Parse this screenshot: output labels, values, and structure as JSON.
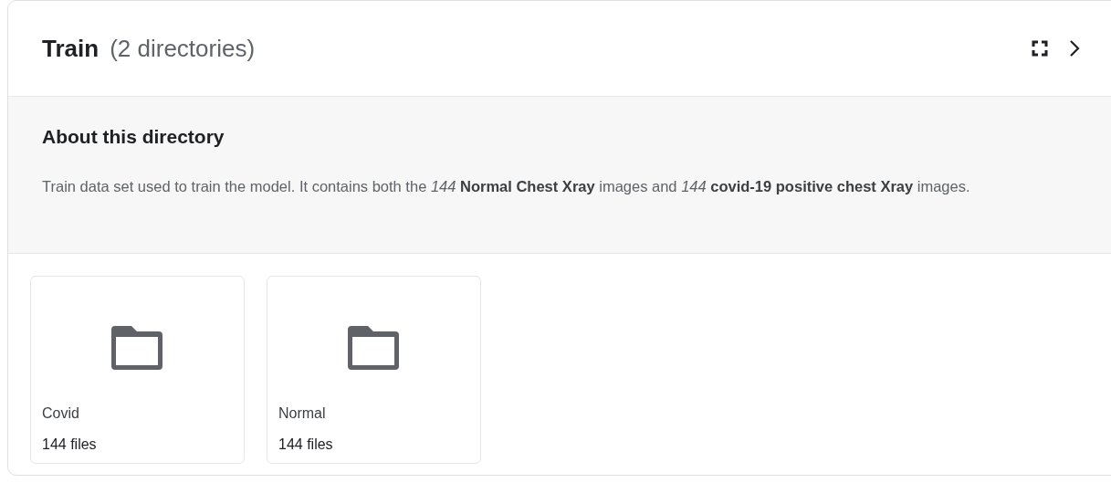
{
  "header": {
    "title": "Train",
    "subtitle": "(2 directories)"
  },
  "about": {
    "heading": "About this directory",
    "description": "Train data set used to train the model. It contains both the *144* **Normal Chest Xray** images and *144* **covid-19 positive chest Xray** images."
  },
  "directories": [
    {
      "name": "Covid",
      "count": "144 files"
    },
    {
      "name": "Normal",
      "count": "144 files"
    }
  ]
}
